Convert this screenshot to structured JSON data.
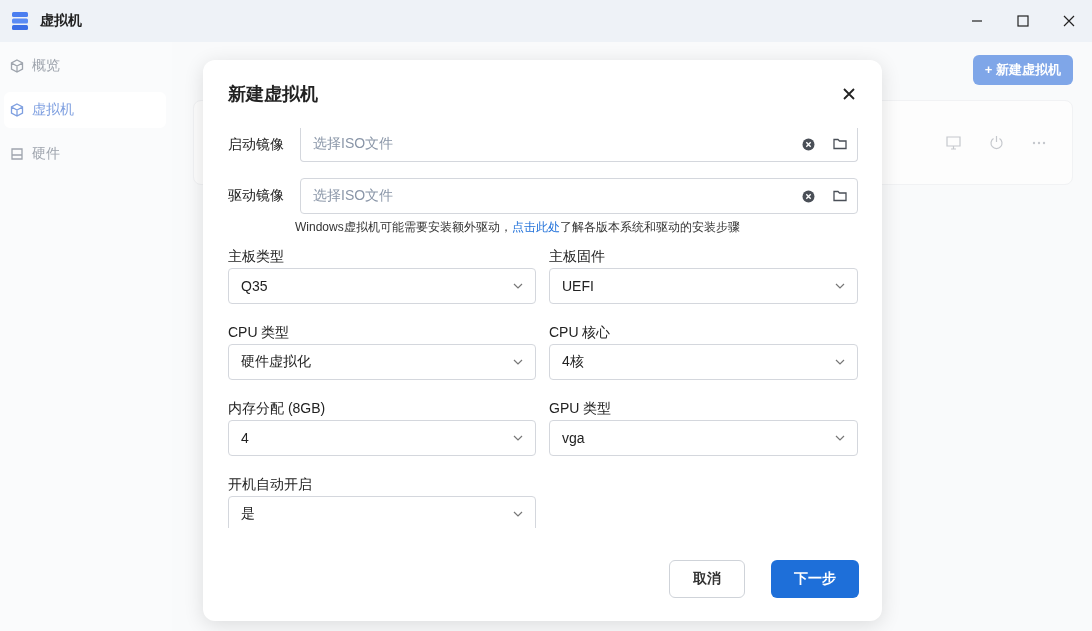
{
  "window": {
    "title": "虚拟机"
  },
  "sidebar": {
    "items": [
      {
        "label": "概览",
        "kind": "cube",
        "selected": false
      },
      {
        "label": "虚拟机",
        "kind": "cube",
        "selected": true
      },
      {
        "label": "硬件",
        "kind": "drive",
        "selected": false
      }
    ]
  },
  "page": {
    "new_button": "+ 新建虚拟机"
  },
  "dialog": {
    "title": "新建虚拟机",
    "image_fields": [
      {
        "label": "启动镜像",
        "placeholder": "选择ISO文件"
      },
      {
        "label": "驱动镜像",
        "placeholder": "选择ISO文件"
      }
    ],
    "hint": {
      "before": "Windows虚拟机可能需要安装额外驱动，",
      "link": "点击此处",
      "after": "了解各版本系统和驱动的安装步骤"
    },
    "selects": [
      {
        "label": "主板类型",
        "value": "Q35"
      },
      {
        "label": "主板固件",
        "value": "UEFI"
      },
      {
        "label": "CPU 类型",
        "value": "硬件虚拟化"
      },
      {
        "label": "CPU 核心",
        "value": "4核"
      },
      {
        "label": "内存分配 (8GB)",
        "value": "4"
      },
      {
        "label": "GPU 类型",
        "value": "vga"
      },
      {
        "label": "开机自动开启",
        "value": "是"
      }
    ],
    "buttons": [
      {
        "label": "取消",
        "kind": "secondary"
      },
      {
        "label": "下一步",
        "kind": "primary"
      }
    ]
  }
}
